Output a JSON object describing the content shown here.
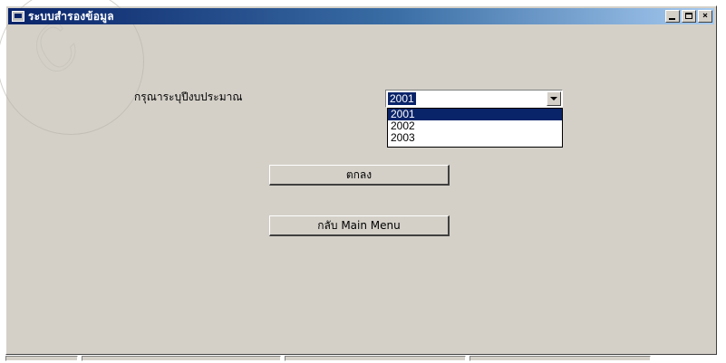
{
  "window": {
    "title": "ระบบสำรองข้อมูล"
  },
  "form": {
    "prompt_label": "กรุณาระบุปีงบประมาณ",
    "year_combo": {
      "selected_value": "2001",
      "options": [
        "2001",
        "2002",
        "2003"
      ],
      "highlighted_index": 0
    },
    "ok_button_label": "ตกลง",
    "back_button_label": "กลับ Main Menu"
  },
  "colors": {
    "face": "#d4d0c8",
    "title_active": "#0a246a",
    "selection": "#0a246a"
  }
}
